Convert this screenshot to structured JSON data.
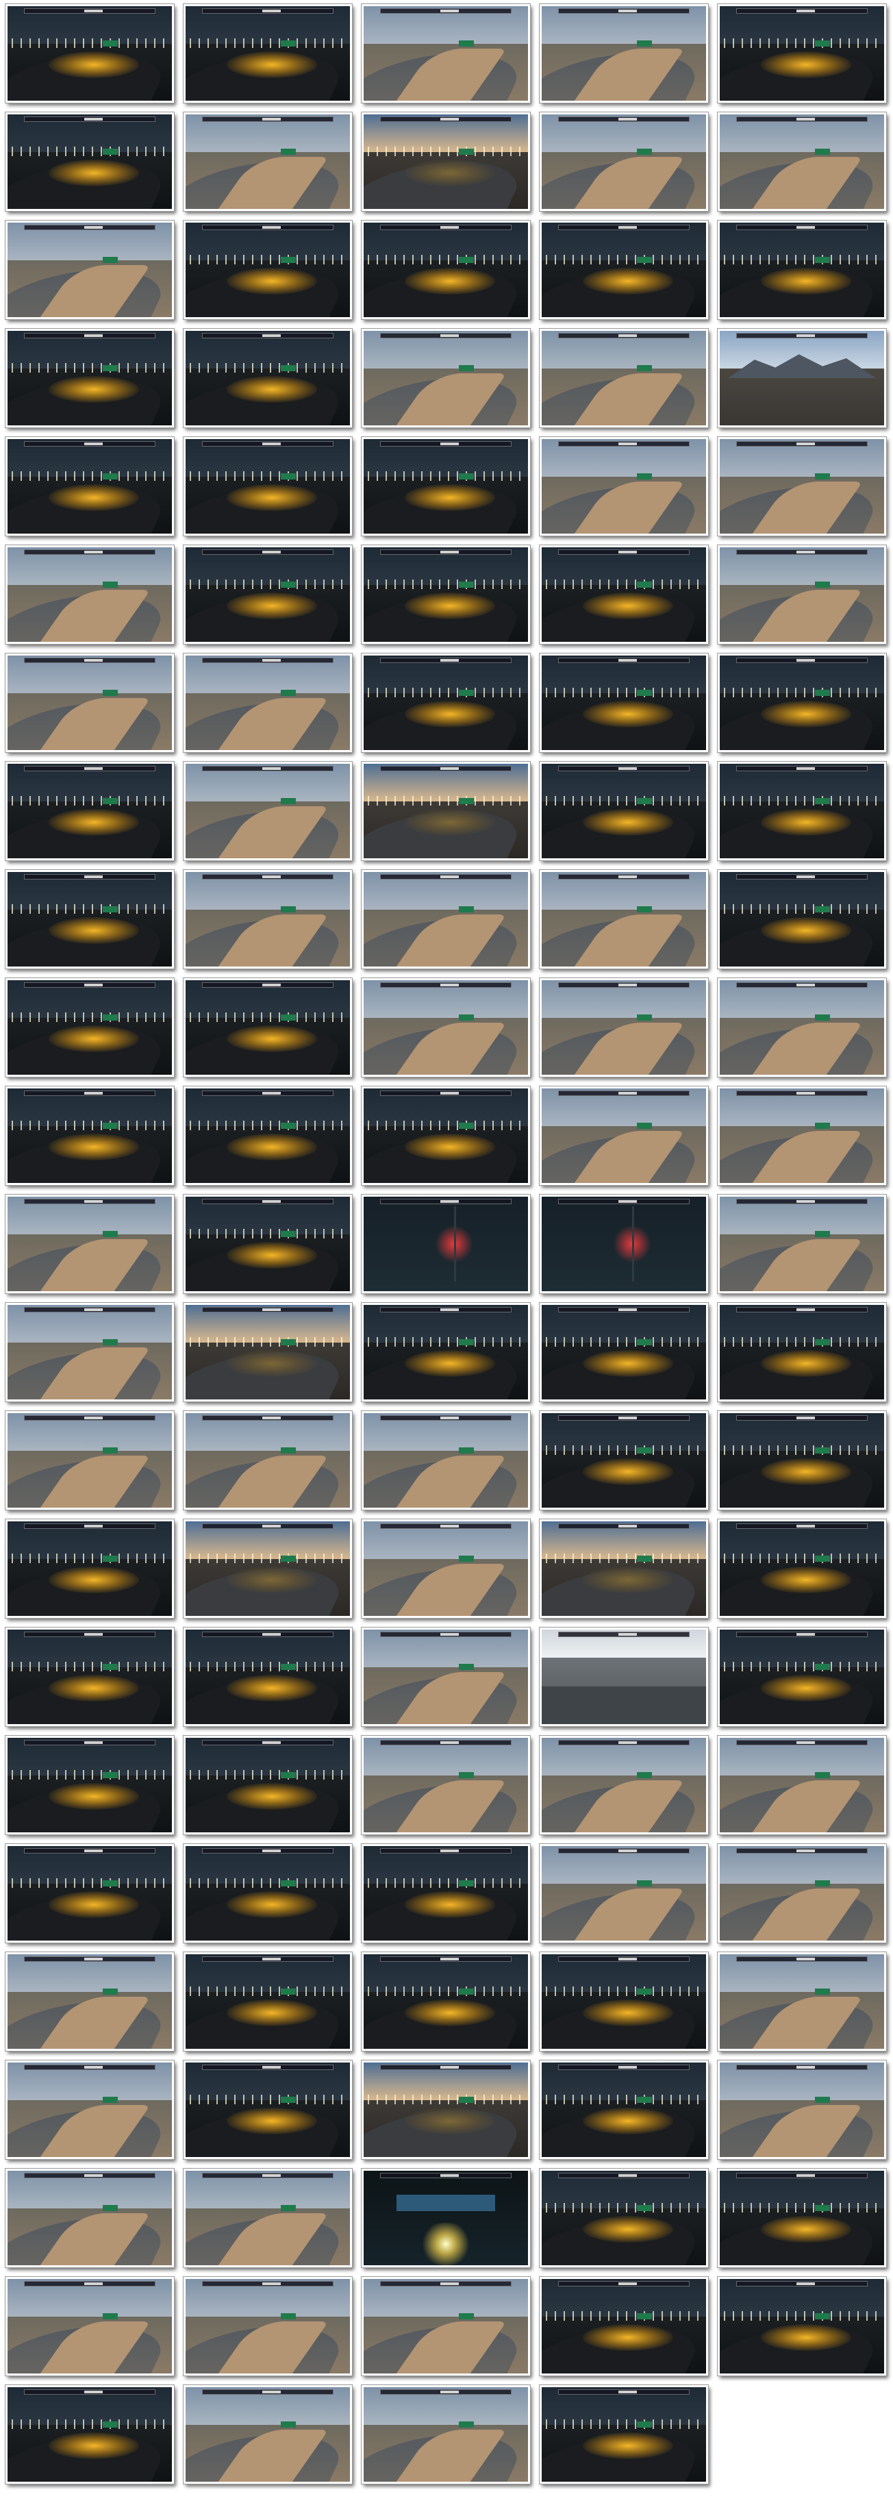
{
  "gallery": {
    "columns": 5,
    "thumbnails": [
      {
        "scene": "night"
      },
      {
        "scene": "night"
      },
      {
        "scene": "day"
      },
      {
        "scene": "day"
      },
      {
        "scene": "night"
      },
      {
        "scene": "night"
      },
      {
        "scene": "day"
      },
      {
        "scene": "dusk"
      },
      {
        "scene": "day"
      },
      {
        "scene": "day"
      },
      {
        "scene": "day"
      },
      {
        "scene": "night"
      },
      {
        "scene": "night"
      },
      {
        "scene": "night"
      },
      {
        "scene": "night"
      },
      {
        "scene": "night"
      },
      {
        "scene": "night"
      },
      {
        "scene": "day"
      },
      {
        "scene": "day"
      },
      {
        "scene": "mountain"
      },
      {
        "scene": "night"
      },
      {
        "scene": "night"
      },
      {
        "scene": "night"
      },
      {
        "scene": "day"
      },
      {
        "scene": "day"
      },
      {
        "scene": "day"
      },
      {
        "scene": "night"
      },
      {
        "scene": "night"
      },
      {
        "scene": "night"
      },
      {
        "scene": "day"
      },
      {
        "scene": "day"
      },
      {
        "scene": "day"
      },
      {
        "scene": "night"
      },
      {
        "scene": "night"
      },
      {
        "scene": "night"
      },
      {
        "scene": "night"
      },
      {
        "scene": "day"
      },
      {
        "scene": "dusk"
      },
      {
        "scene": "night"
      },
      {
        "scene": "night"
      },
      {
        "scene": "night"
      },
      {
        "scene": "day"
      },
      {
        "scene": "day"
      },
      {
        "scene": "day"
      },
      {
        "scene": "night"
      },
      {
        "scene": "night"
      },
      {
        "scene": "night"
      },
      {
        "scene": "day"
      },
      {
        "scene": "day"
      },
      {
        "scene": "day"
      },
      {
        "scene": "night"
      },
      {
        "scene": "night"
      },
      {
        "scene": "night"
      },
      {
        "scene": "day"
      },
      {
        "scene": "day"
      },
      {
        "scene": "day"
      },
      {
        "scene": "night"
      },
      {
        "scene": "street"
      },
      {
        "scene": "street"
      },
      {
        "scene": "day"
      },
      {
        "scene": "day"
      },
      {
        "scene": "dusk"
      },
      {
        "scene": "night"
      },
      {
        "scene": "night"
      },
      {
        "scene": "night"
      },
      {
        "scene": "day"
      },
      {
        "scene": "day"
      },
      {
        "scene": "day"
      },
      {
        "scene": "night"
      },
      {
        "scene": "night"
      },
      {
        "scene": "night"
      },
      {
        "scene": "dusk"
      },
      {
        "scene": "day"
      },
      {
        "scene": "dusk"
      },
      {
        "scene": "night"
      },
      {
        "scene": "night"
      },
      {
        "scene": "night"
      },
      {
        "scene": "day"
      },
      {
        "scene": "city"
      },
      {
        "scene": "night"
      },
      {
        "scene": "night"
      },
      {
        "scene": "night"
      },
      {
        "scene": "day"
      },
      {
        "scene": "day"
      },
      {
        "scene": "day"
      },
      {
        "scene": "night"
      },
      {
        "scene": "night"
      },
      {
        "scene": "night"
      },
      {
        "scene": "day"
      },
      {
        "scene": "day"
      },
      {
        "scene": "day"
      },
      {
        "scene": "night"
      },
      {
        "scene": "night"
      },
      {
        "scene": "night"
      },
      {
        "scene": "day"
      },
      {
        "scene": "day"
      },
      {
        "scene": "night"
      },
      {
        "scene": "dusk"
      },
      {
        "scene": "night"
      },
      {
        "scene": "day"
      },
      {
        "scene": "day"
      },
      {
        "scene": "day"
      },
      {
        "scene": "flare"
      },
      {
        "scene": "night"
      },
      {
        "scene": "night"
      },
      {
        "scene": "day"
      },
      {
        "scene": "day"
      },
      {
        "scene": "day"
      },
      {
        "scene": "night"
      },
      {
        "scene": "night"
      },
      {
        "scene": "night"
      },
      {
        "scene": "day"
      },
      {
        "scene": "day"
      },
      {
        "scene": "night"
      }
    ]
  }
}
